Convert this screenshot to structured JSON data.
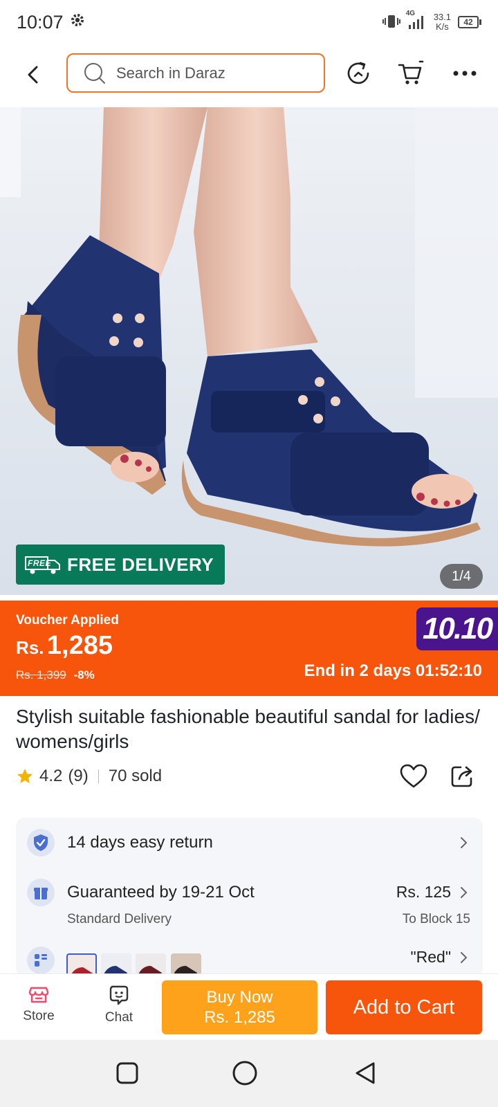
{
  "status_bar": {
    "time": "10:07",
    "network_type": "4G",
    "net_speed_value": "33.1",
    "net_speed_unit": "K/s",
    "battery_level": "42"
  },
  "header": {
    "search_placeholder": "Search in Daraz",
    "icons": [
      "back-icon",
      "search-icon",
      "history-icon",
      "cart-icon",
      "more-icon"
    ]
  },
  "product_image": {
    "badge_text": "FREE DELIVERY",
    "badge_icon_text": "FREE",
    "counter": "1/4"
  },
  "price_banner": {
    "voucher_label": "Voucher Applied",
    "currency": "Rs.",
    "price": "1,285",
    "old_price": "Rs. 1,399",
    "discount": "-8%",
    "campaign_badge": "10.10",
    "countdown": "End in 2 days 01:52:10",
    "accent_color": "#f7550c",
    "badge_color": "#4a148c"
  },
  "product": {
    "title": "Stylish suitable fashionable beautiful sandal for ladies/ womens/girls",
    "rating": "4.2",
    "reviews": "(9)",
    "sold": "70 sold"
  },
  "services": {
    "return_text": "14 days easy return",
    "delivery_title": "Guaranteed by 19-21 Oct",
    "delivery_type": "Standard Delivery",
    "delivery_price": "Rs. 125",
    "delivery_location": "To Block 15",
    "variant_selected": "\"Red\""
  },
  "action_bar": {
    "store_label": "Store",
    "chat_label": "Chat",
    "buy_now_label": "Buy Now",
    "buy_now_price": "Rs. 1,285",
    "add_to_cart_label": "Add to Cart",
    "buy_color": "#fda21a",
    "cart_color": "#f7550c"
  }
}
